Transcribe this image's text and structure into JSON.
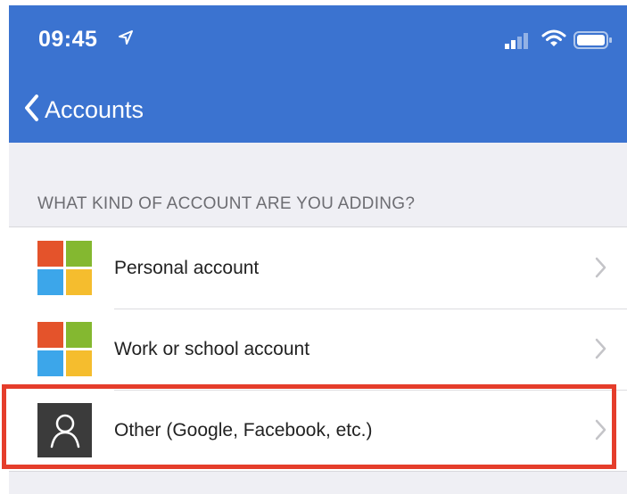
{
  "status_bar": {
    "time": "09:45"
  },
  "nav": {
    "back_label": "Accounts"
  },
  "section": {
    "header": "WHAT KIND OF ACCOUNT ARE YOU ADDING?"
  },
  "accounts": [
    {
      "label": "Personal account",
      "icon": "microsoft-logo-icon"
    },
    {
      "label": "Work or school account",
      "icon": "microsoft-logo-icon"
    },
    {
      "label": "Other (Google, Facebook, etc.)",
      "icon": "person-icon"
    }
  ],
  "colors": {
    "header_blue": "#3b73d0",
    "highlight_red": "#e53d2b",
    "ms_red": "#e4532b",
    "ms_green": "#84b830",
    "ms_blue": "#3ca6ea",
    "ms_yellow": "#f5bd2e"
  }
}
